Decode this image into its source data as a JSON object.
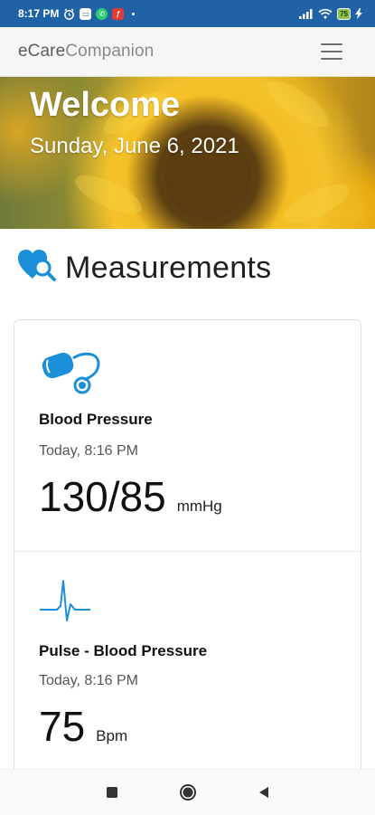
{
  "status_bar": {
    "time": "8:17 PM",
    "battery": "75",
    "icons": [
      "alarm-icon",
      "messages-icon",
      "whatsapp-icon",
      "notification-app-icon",
      "signal-icon",
      "wifi-icon",
      "battery-icon",
      "charging-icon"
    ]
  },
  "app_bar": {
    "logo_prefix": "eCare",
    "logo_suffix": "Companion",
    "menu_icon": "hamburger-menu-icon"
  },
  "hero": {
    "title": "Welcome",
    "date": "Sunday, June 6, 2021"
  },
  "section": {
    "title": "Measurements",
    "icon": "heart-search-icon"
  },
  "measurements": [
    {
      "icon": "blood-pressure-cuff-icon",
      "label": "Blood Pressure",
      "time": "Today, 8:16 PM",
      "value": "130/85",
      "unit": "mmHg"
    },
    {
      "icon": "pulse-waveform-icon",
      "label": "Pulse - Blood Pressure",
      "time": "Today, 8:16 PM",
      "value": "75",
      "unit": "Bpm"
    }
  ],
  "nav_bar": {
    "buttons": [
      "recent-apps-icon",
      "home-icon",
      "back-icon"
    ]
  },
  "colors": {
    "status_bar": "#1f63a6",
    "accent_blue": "#1c8fd9",
    "app_bar_bg": "#f6f6f6"
  }
}
